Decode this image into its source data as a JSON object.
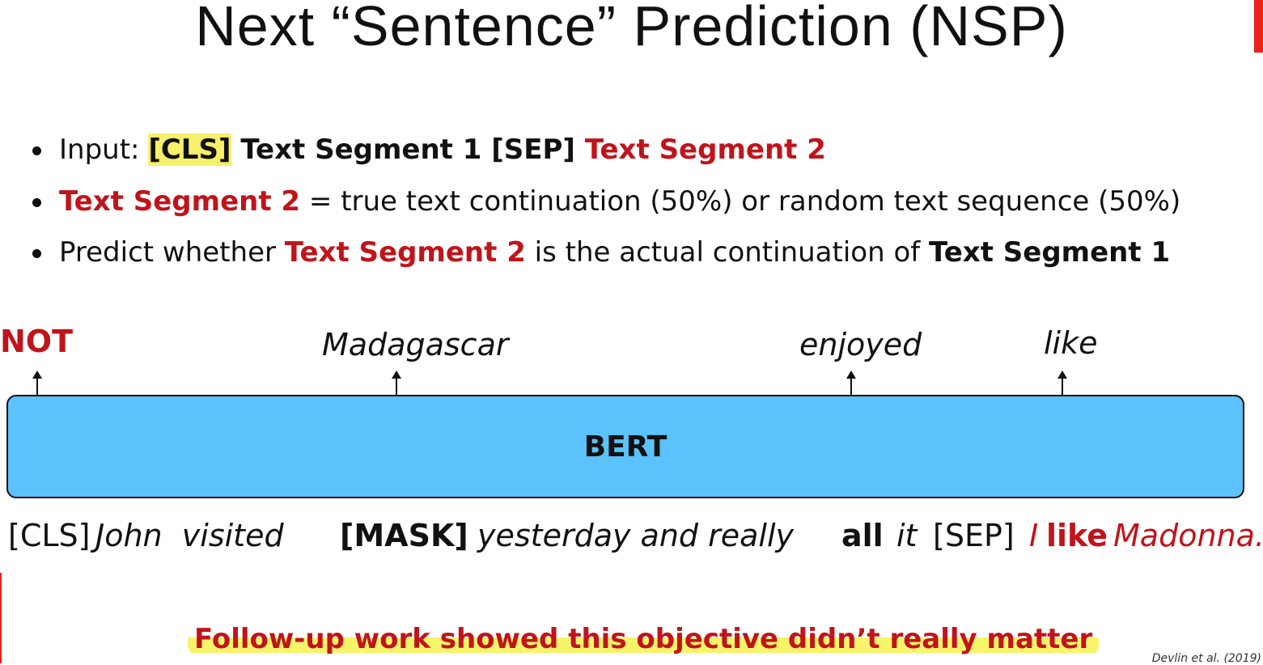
{
  "title": "Next “Sentence” Prediction (NSP)",
  "bullets": {
    "b1": {
      "prefix": "Input: ",
      "cls": "[CLS]",
      "seg1": " Text Segment 1 [SEP] ",
      "seg2": "Text Segment 2"
    },
    "b2": {
      "seg2": "Text Segment 2",
      "rest": " = true text continuation (50%) or random text sequence (50%)"
    },
    "b3": {
      "prefix": "Predict whether ",
      "seg2": "Text Segment 2",
      "mid": " is the actual continuation of ",
      "seg1": "Text Segment 1"
    }
  },
  "outputs": {
    "not": "NOT",
    "madagascar": "Madagascar",
    "enjoyed": "enjoyed",
    "like": "like"
  },
  "model": "BERT",
  "tokens": {
    "cls": "[CLS]",
    "john_visited": "John  visited",
    "mask": "[MASK]",
    "yesterday": "yesterday and really",
    "all": "all",
    "it": "it",
    "sep": "[SEP]",
    "i": "I",
    "like": "like",
    "madonna": "Madonna."
  },
  "footer": "Follow-up work showed this objective didn’t really matter",
  "citation": "Devlin et al. (2019)",
  "colors": {
    "accent": "#c0141b",
    "bert": "#5bc2fb",
    "highlight": "#f6f06a"
  }
}
